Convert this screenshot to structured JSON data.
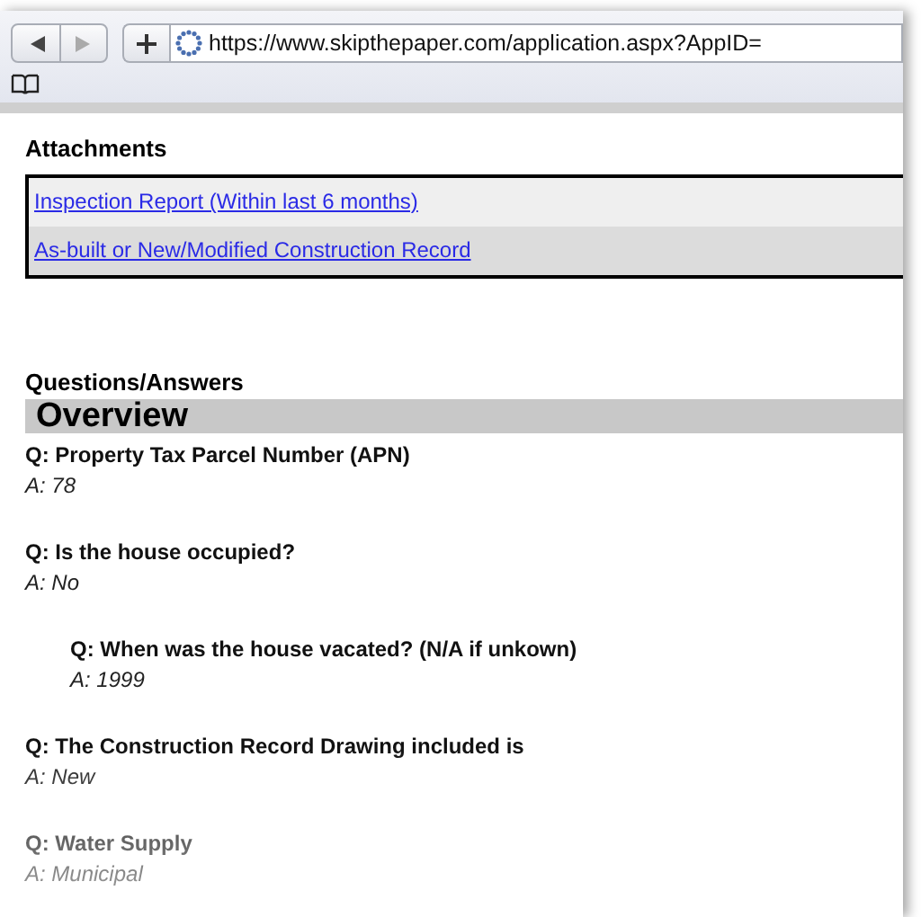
{
  "browser": {
    "url": "https://www.skipthepaper.com/application.aspx?AppID="
  },
  "attachments": {
    "title": "Attachments",
    "links": [
      {
        "label": "Inspection Report (Within last 6 months)"
      },
      {
        "label": "As-built or New/Modified Construction Record"
      }
    ]
  },
  "qa": {
    "title": "Questions/Answers",
    "section": "Overview",
    "items": [
      {
        "question": "Q: Property Tax Parcel Number (APN)",
        "answer": "A: 78"
      },
      {
        "question": "Q: Is the house occupied?",
        "answer": "A: No",
        "children": [
          {
            "question": "Q: When was the house vacated? (N/A if unkown)",
            "answer": "A: 1999"
          }
        ]
      },
      {
        "question": "Q: The Construction Record Drawing included is",
        "answer": "A: New"
      },
      {
        "question": "Q: Water Supply",
        "answer": "A: Municipal"
      }
    ]
  }
}
